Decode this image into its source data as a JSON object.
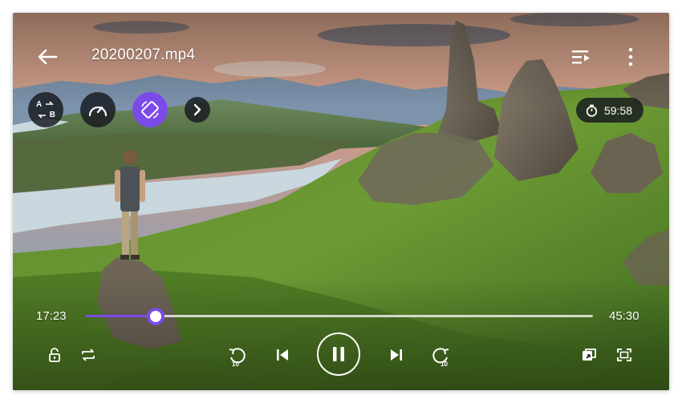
{
  "header": {
    "title": "20200207.mp4"
  },
  "tools": [
    {
      "name": "ab-repeat",
      "label_a": "A",
      "label_b": "B"
    },
    {
      "name": "speed"
    },
    {
      "name": "rotate",
      "active": true
    },
    {
      "name": "more-tools"
    }
  ],
  "sleep_timer": {
    "value": "59:58"
  },
  "playback": {
    "elapsed": "17:23",
    "duration": "45:30",
    "progress": 0.137,
    "rewind_seconds": "10",
    "forward_seconds": "10",
    "state": "playing"
  },
  "icons": {
    "back": "arrow-left-icon",
    "playlist": "playlist-icon",
    "menu": "more-vertical-icon",
    "timer": "timer-icon",
    "lock": "lock-icon",
    "loop": "loop-icon",
    "rewind": "rewind-10-icon",
    "previous": "skip-previous-icon",
    "pause": "pause-icon",
    "next": "skip-next-icon",
    "forward": "forward-10-icon",
    "pip": "picture-in-picture-icon",
    "fullscreen": "fullscreen-icon"
  },
  "colors": {
    "accent": "#7b4be8",
    "control_bg": "#16181e"
  }
}
